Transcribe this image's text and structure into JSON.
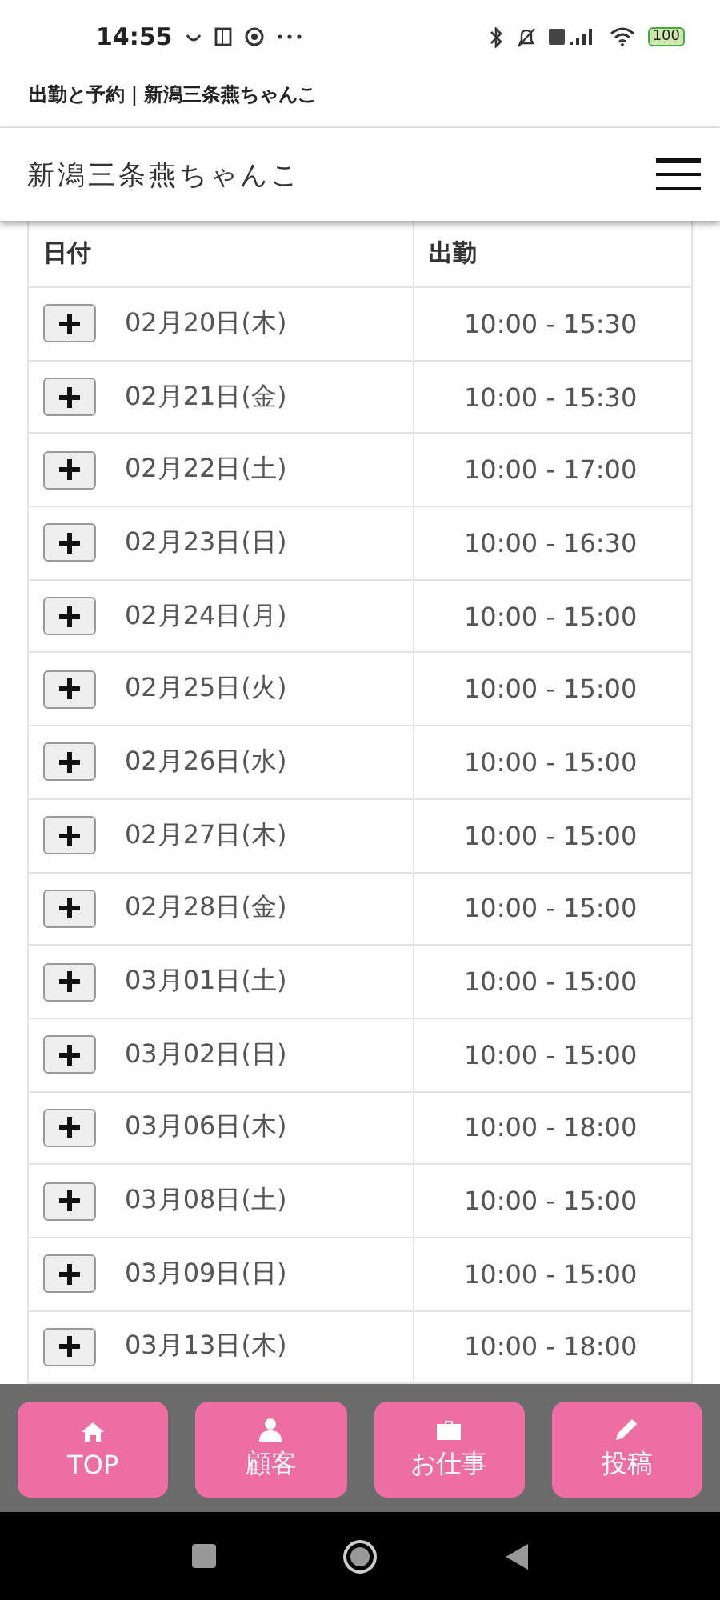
{
  "status_bar": {
    "time": "14:55",
    "battery": "100"
  },
  "page_title": "出勤と予約｜新潟三条燕ちゃんこ",
  "header": {
    "site_name": "新潟三条燕ちゃんこ"
  },
  "table": {
    "columns": [
      "日付",
      "出勤"
    ],
    "rows": [
      {
        "date": "02月20日(木)",
        "hours": "10:00 - 15:30"
      },
      {
        "date": "02月21日(金)",
        "hours": "10:00 - 15:30"
      },
      {
        "date": "02月22日(土)",
        "hours": "10:00 - 17:00"
      },
      {
        "date": "02月23日(日)",
        "hours": "10:00 - 16:30"
      },
      {
        "date": "02月24日(月)",
        "hours": "10:00 - 15:00"
      },
      {
        "date": "02月25日(火)",
        "hours": "10:00 - 15:00"
      },
      {
        "date": "02月26日(水)",
        "hours": "10:00 - 15:00"
      },
      {
        "date": "02月27日(木)",
        "hours": "10:00 - 15:00"
      },
      {
        "date": "02月28日(金)",
        "hours": "10:00 - 15:00"
      },
      {
        "date": "03月01日(土)",
        "hours": "10:00 - 15:00"
      },
      {
        "date": "03月02日(日)",
        "hours": "10:00 - 15:00"
      },
      {
        "date": "03月06日(木)",
        "hours": "10:00 - 18:00"
      },
      {
        "date": "03月08日(土)",
        "hours": "10:00 - 15:00"
      },
      {
        "date": "03月09日(日)",
        "hours": "10:00 - 15:00"
      },
      {
        "date": "03月13日(木)",
        "hours": "10:00 - 18:00"
      }
    ]
  },
  "bottom_nav": [
    {
      "kind": "home",
      "label": "TOP"
    },
    {
      "kind": "person",
      "label": "顧客"
    },
    {
      "kind": "briefcase",
      "label": "お仕事"
    },
    {
      "kind": "pencil",
      "label": "投稿"
    }
  ]
}
